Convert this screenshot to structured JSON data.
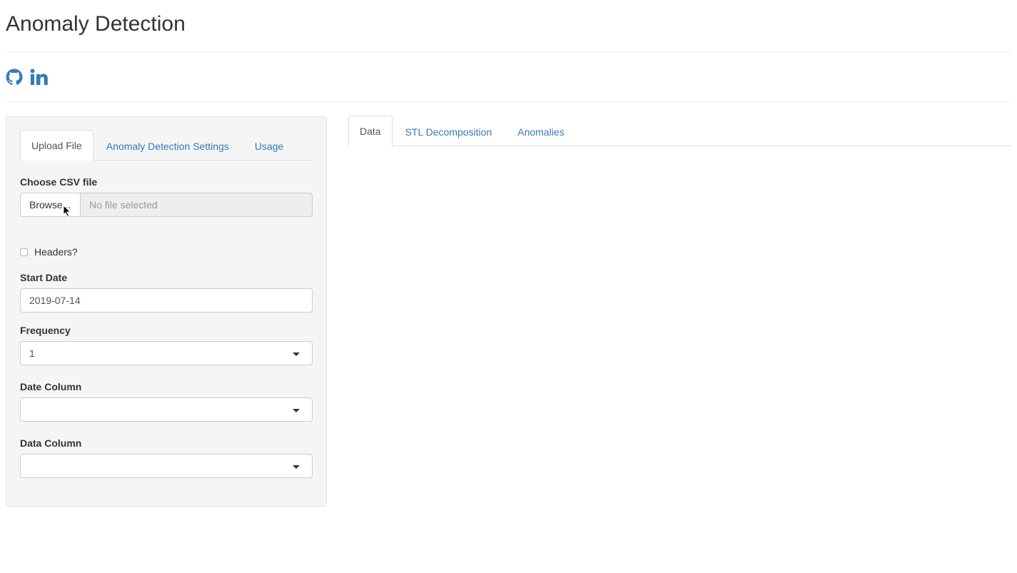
{
  "app": {
    "title": "Anomaly Detection"
  },
  "social": {
    "github_icon": "github-icon",
    "linkedin_icon": "linkedin-icon",
    "accent": "#337ab7"
  },
  "sidebar": {
    "tabs": [
      {
        "label": "Upload File",
        "active": true
      },
      {
        "label": "Anomaly Detection Settings",
        "active": false
      },
      {
        "label": "Usage",
        "active": false
      }
    ],
    "csv": {
      "label": "Choose CSV file",
      "browse_label": "Browse...",
      "file_placeholder": "No file selected"
    },
    "headers": {
      "label": "Headers?",
      "checked": false
    },
    "start_date": {
      "label": "Start Date",
      "value": "2019-07-14"
    },
    "frequency": {
      "label": "Frequency",
      "value": "1"
    },
    "date_column": {
      "label": "Date Column",
      "value": ""
    },
    "data_column": {
      "label": "Data Column",
      "value": ""
    }
  },
  "main": {
    "tabs": [
      {
        "label": "Data",
        "active": true
      },
      {
        "label": "STL Decomposition",
        "active": false
      },
      {
        "label": "Anomalies",
        "active": false
      }
    ]
  }
}
